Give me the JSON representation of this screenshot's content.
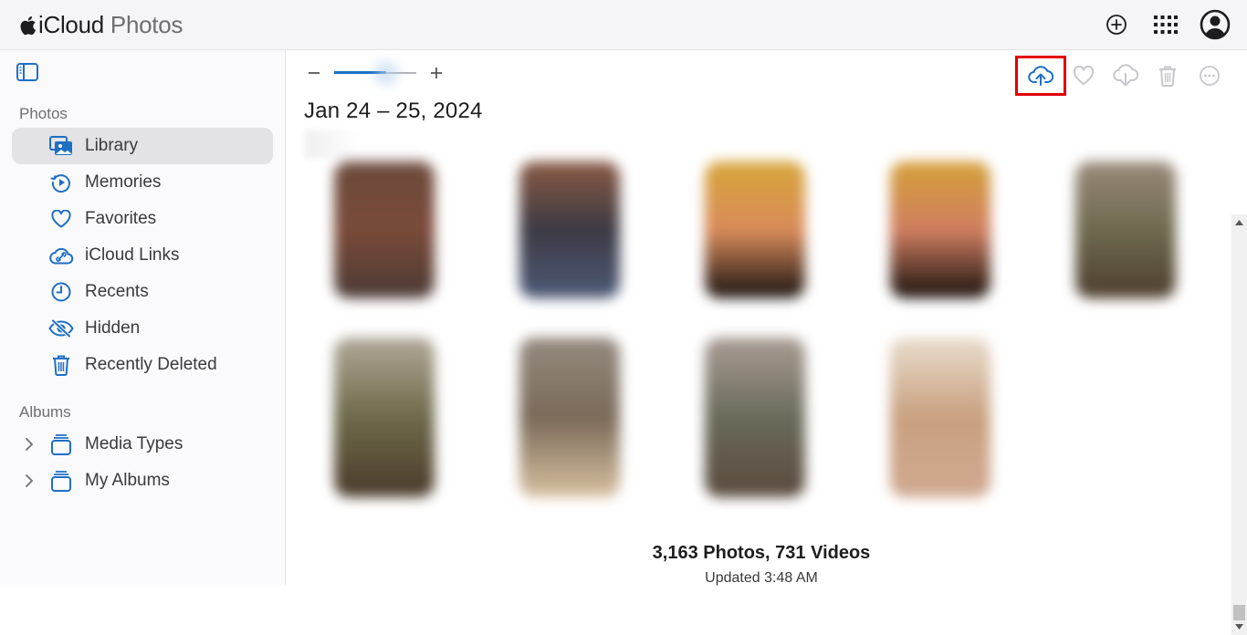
{
  "header": {
    "brand_primary": "iCloud",
    "brand_secondary": "Photos",
    "icons": [
      "apple-logo-icon",
      "add-circle-icon",
      "app-grid-icon",
      "account-icon"
    ]
  },
  "sidebar": {
    "toggle_icon": "sidebar-toggle-icon",
    "photos_section_title": "Photos",
    "photos_items": [
      {
        "label": "Library",
        "icon": "library-icon",
        "active": true
      },
      {
        "label": "Memories",
        "icon": "memories-icon",
        "active": false
      },
      {
        "label": "Favorites",
        "icon": "heart-icon",
        "active": false
      },
      {
        "label": "iCloud Links",
        "icon": "cloud-link-icon",
        "active": false
      },
      {
        "label": "Recents",
        "icon": "clock-icon",
        "active": false
      },
      {
        "label": "Hidden",
        "icon": "eye-slash-icon",
        "active": false
      },
      {
        "label": "Recently Deleted",
        "icon": "trash-icon",
        "active": false
      }
    ],
    "albums_section_title": "Albums",
    "albums_items": [
      {
        "label": "Media Types",
        "icon": "album-stack-icon",
        "expanded": false
      },
      {
        "label": "My Albums",
        "icon": "album-stack-icon",
        "expanded": false
      }
    ]
  },
  "toolbar": {
    "zoom_out_label": "−",
    "zoom_in_label": "+",
    "zoom_level_fraction": 0.66,
    "actions": [
      {
        "name": "upload",
        "icon": "cloud-upload-icon",
        "enabled": true,
        "highlighted": true
      },
      {
        "name": "favorite",
        "icon": "heart-icon",
        "enabled": false
      },
      {
        "name": "download",
        "icon": "cloud-download-icon",
        "enabled": false
      },
      {
        "name": "delete",
        "icon": "trash-icon",
        "enabled": false
      },
      {
        "name": "more",
        "icon": "more-ellipsis-icon",
        "enabled": false
      }
    ]
  },
  "main": {
    "date_title": "Jan 24 – 25, 2024",
    "photos": [
      {
        "row": 0,
        "col": 0,
        "colors": [
          "#6b4a3c",
          "#7a4a38",
          "#4a3a36"
        ]
      },
      {
        "row": 0,
        "col": 1,
        "colors": [
          "#8a5a44",
          "#3c3a44",
          "#4e5a78"
        ]
      },
      {
        "row": 0,
        "col": 2,
        "colors": [
          "#d6a53a",
          "#d98b5a",
          "#1a1412"
        ]
      },
      {
        "row": 0,
        "col": 3,
        "colors": [
          "#d4a03a",
          "#cf7e60",
          "#1a120e"
        ]
      },
      {
        "row": 0,
        "col": 4,
        "colors": [
          "#9a8a7a",
          "#6e6a4e",
          "#4e3e2e"
        ]
      },
      {
        "row": 1,
        "col": 0,
        "colors": [
          "#b0a898",
          "#6e6a4a",
          "#4a3a2a"
        ]
      },
      {
        "row": 1,
        "col": 1,
        "colors": [
          "#948a80",
          "#7a6a58",
          "#d8c0a0"
        ]
      },
      {
        "row": 1,
        "col": 2,
        "colors": [
          "#a89c94",
          "#6a6a5a",
          "#5a4a3e"
        ]
      },
      {
        "row": 1,
        "col": 3,
        "colors": [
          "#e8dccc",
          "#c8a080",
          "#d0a890"
        ]
      }
    ],
    "count_summary": "3,163 Photos, 731 Videos",
    "updated_text": "Updated 3:48 AM"
  },
  "colors": {
    "accent": "#1f6fc5",
    "highlight_box": "#e00000",
    "disabled_icon": "#c7c7cc",
    "active_item_bg": "#e3e3e6"
  }
}
